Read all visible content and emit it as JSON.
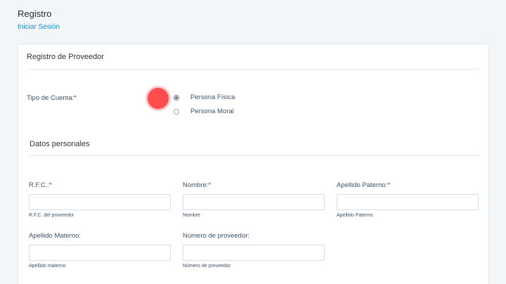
{
  "header": {
    "title": "Registro",
    "login_link": "Iniciar Sesión"
  },
  "card": {
    "title": "Registro de Proveedor",
    "account_type_label": "Tipo de Cuenta:*",
    "account_types": [
      {
        "label": "Persona Física",
        "selected": true
      },
      {
        "label": "Persona Moral",
        "selected": false
      }
    ],
    "section_title": "Datos personales",
    "fields": [
      {
        "label": "R.F.C.:*",
        "value": "",
        "help": "R.F.C. del proveedor"
      },
      {
        "label": "Nombre:*",
        "value": "",
        "help": "Nombre"
      },
      {
        "label": "Apellido Paterno:*",
        "value": "",
        "help": "Apellido Paterno"
      },
      {
        "label": "Apellido Materno:",
        "value": "",
        "help": "Apellido materno"
      },
      {
        "label": "Número de proveedor:",
        "value": "",
        "help": "Número de proveedor"
      }
    ]
  },
  "colors": {
    "accent_link": "#1a8fd0",
    "label_text": "#3d5266",
    "cursor_indicator": "#ff4d4f",
    "page_background": "#f2f6f9"
  }
}
